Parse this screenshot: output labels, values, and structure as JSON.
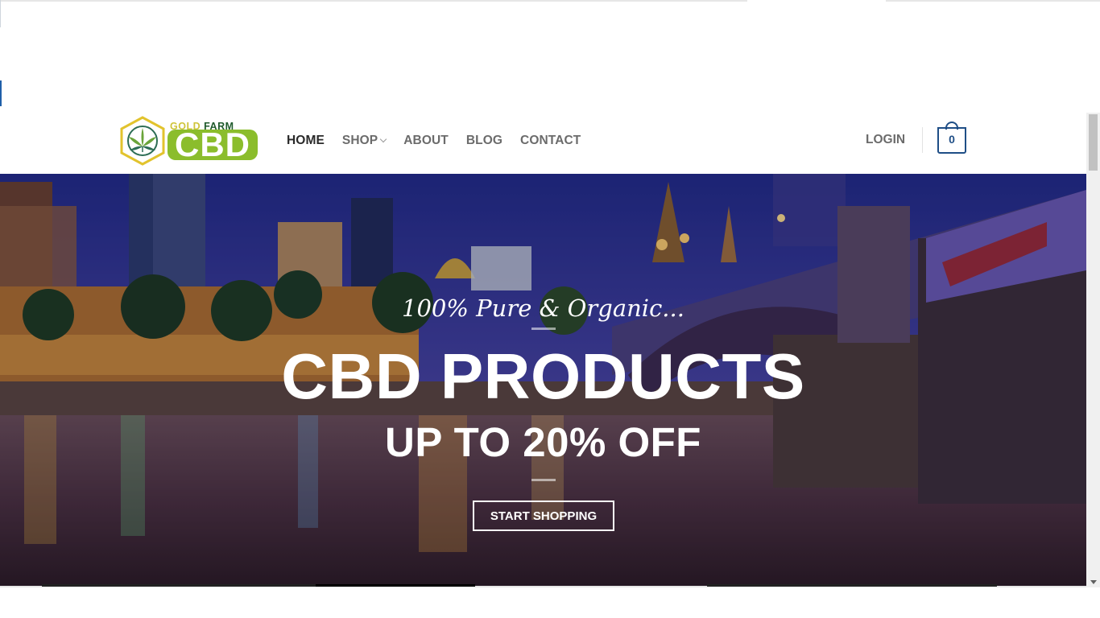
{
  "brand": {
    "logo_small_1": "GOLD",
    "logo_small_2": "FARM",
    "logo_big": "CBD",
    "colors": {
      "gold": "#cfc43a",
      "green": "#8bbd2c",
      "dark_green": "#1f5a2c"
    }
  },
  "nav": {
    "items": [
      {
        "label": "HOME",
        "active": true
      },
      {
        "label": "SHOP",
        "has_dropdown": true
      },
      {
        "label": "ABOUT"
      },
      {
        "label": "BLOG"
      },
      {
        "label": "CONTACT"
      }
    ],
    "login_label": "LOGIN",
    "cart_count": "0",
    "cart_icon": "shopping-bag-icon",
    "accent": "#1f4e86"
  },
  "hero": {
    "tagline": "100% Pure & Organic...",
    "headline": "CBD PRODUCTS",
    "subhead": "UP TO 20% OFF",
    "cta_label": "START SHOPPING",
    "background": "night city skyline with illuminated bridge over river"
  }
}
